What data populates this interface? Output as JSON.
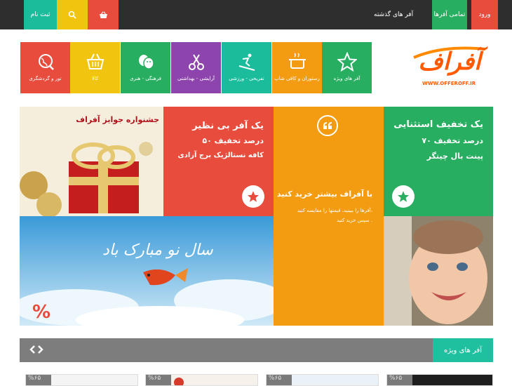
{
  "topbar": {
    "login_label": "ورود",
    "all_offers_label": "تمامی آفرها",
    "past_offers_label": "آفر های گذشته",
    "register_label": "ثبت نام",
    "search_icon": "search-icon",
    "basket_icon": "basket-icon"
  },
  "logo": {
    "title": "آفراف",
    "url_text": "WWW.OFFEROFF.IR"
  },
  "categories": [
    {
      "label": "آفر های ویژه",
      "color": "#27ae60",
      "icon": "star-icon"
    },
    {
      "label": "رستوران و کافی شاپ",
      "color": "#f39c12",
      "icon": "pot-icon"
    },
    {
      "label": "تفریحی - ورزشی",
      "color": "#1abc9c",
      "icon": "skier-icon"
    },
    {
      "label": "آرایشی - بهداشتی",
      "color": "#8e44ad",
      "icon": "scissors-icon"
    },
    {
      "label": "فرهنگی - هنری",
      "color": "#27ae60",
      "icon": "masks-icon"
    },
    {
      "label": "کالا",
      "color": "#f1c40f",
      "icon": "basket-icon"
    },
    {
      "label": "تور و گردشگری",
      "color": "#e74c3c",
      "icon": "globe-icon"
    }
  ],
  "tiles": {
    "green_offer": {
      "line1": "یک تخفیف استثنایی",
      "line2": "۷۰ درصد تخفیف",
      "line3": "پینت بال چیتگر"
    },
    "orange_offer": {
      "heading": "با آفراف بیشتر خرید کنید",
      "body1": "آفرها را ببینید، قیمتها را مقایسه کنید،",
      "body2": "سپس خرید کنید ."
    },
    "red_offer": {
      "line1": "یک آفر بی نظیر",
      "line2": "۵۰ درصد تخفیف",
      "line3": "کافه نستالژیک برج آزادی"
    },
    "gift_banner": {
      "caption": "جشنواره جوایز آفراف"
    },
    "nowruz_banner": {
      "caption": "سال نو مبارک باد",
      "percent": "%"
    }
  },
  "special_section": {
    "title": "آفر های ویژه",
    "prev_icon": "chevron-left-icon",
    "next_icon": "chevron-right-icon"
  },
  "cards": [
    {
      "badge": "%۶۵"
    },
    {
      "badge": "%۶۵"
    },
    {
      "badge": "%۶۵"
    },
    {
      "badge": "%۶۵"
    }
  ]
}
